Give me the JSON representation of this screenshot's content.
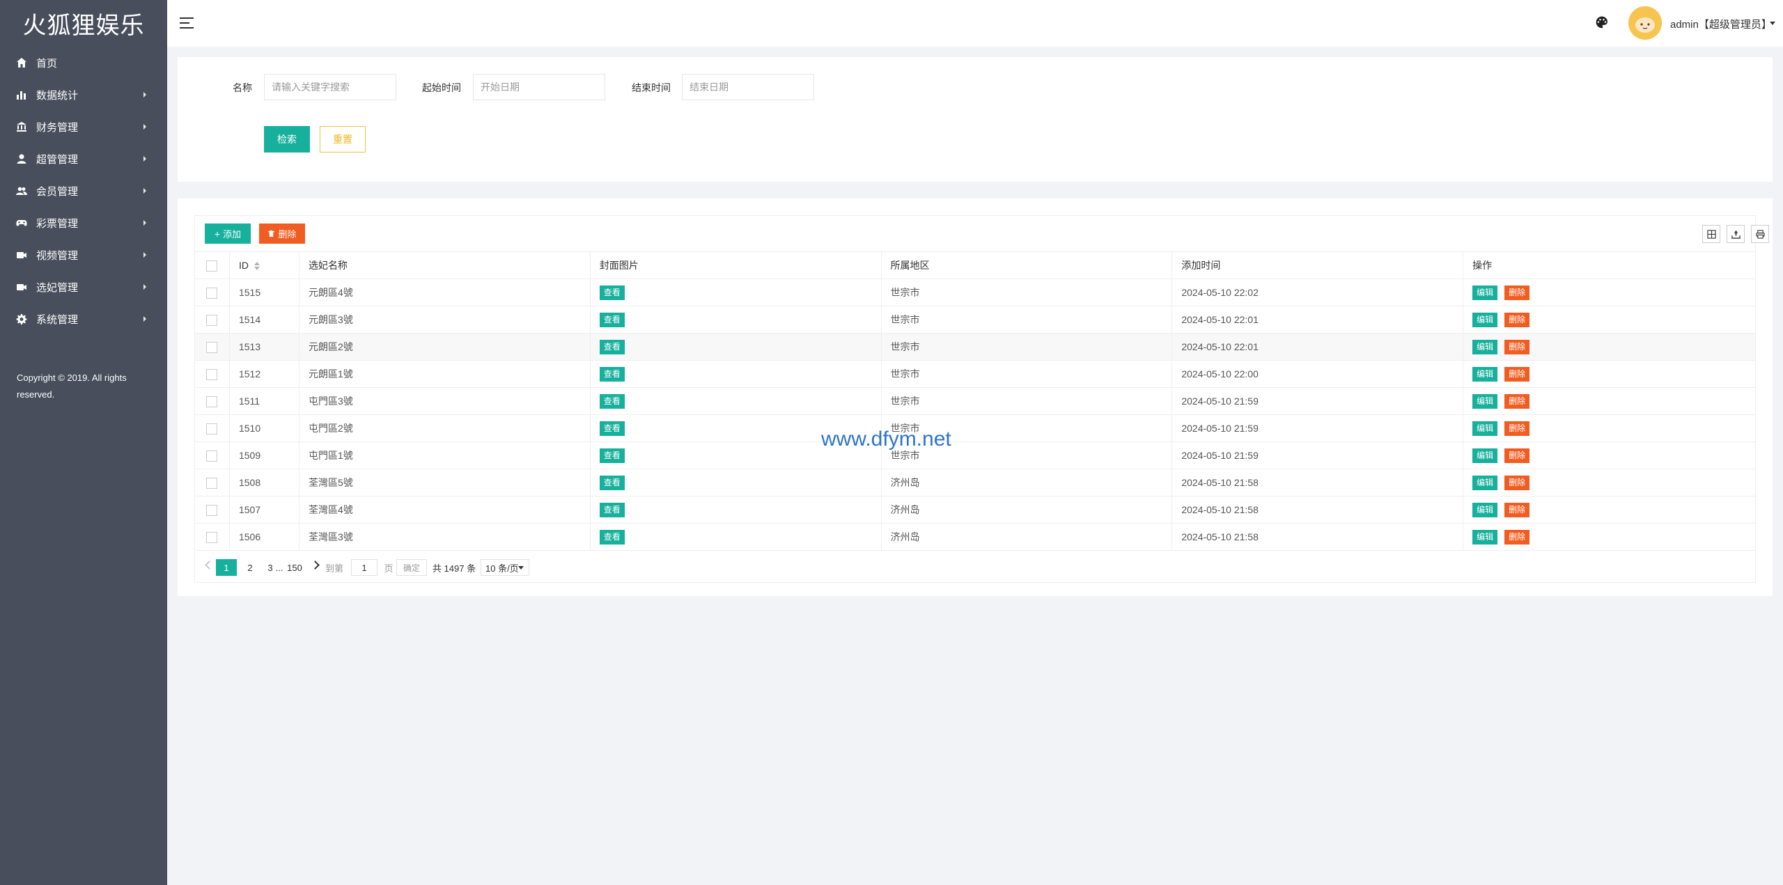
{
  "app": {
    "title": "火狐狸娱乐"
  },
  "sidebar": {
    "items": [
      {
        "label": "首页",
        "icon": "home-icon",
        "has_children": false
      },
      {
        "label": "数据统计",
        "icon": "bar-chart-icon",
        "has_children": true
      },
      {
        "label": "财务管理",
        "icon": "bank-icon",
        "has_children": true
      },
      {
        "label": "超管管理",
        "icon": "user-icon",
        "has_children": true
      },
      {
        "label": "会员管理",
        "icon": "users-icon",
        "has_children": true
      },
      {
        "label": "彩票管理",
        "icon": "gamepad-icon",
        "has_children": true
      },
      {
        "label": "视频管理",
        "icon": "video-icon",
        "has_children": true
      },
      {
        "label": "选妃管理",
        "icon": "video-camera-icon",
        "has_children": true
      },
      {
        "label": "系统管理",
        "icon": "gear-icon",
        "has_children": true
      }
    ],
    "copyright": "Copyright © 2019. All rights reserved."
  },
  "header": {
    "user": "admin【超级管理员】"
  },
  "search": {
    "name_label": "名称",
    "name_placeholder": "请输入关键字搜索",
    "start_label": "起始时间",
    "start_placeholder": "开始日期",
    "end_label": "结束时间",
    "end_placeholder": "结束日期",
    "search_button": "检索",
    "reset_button": "重置"
  },
  "toolbar": {
    "add_label": "添加",
    "delete_label": "删除"
  },
  "table": {
    "columns": [
      "ID",
      "选妃名称",
      "封面图片",
      "所属地区",
      "添加时间",
      "操作"
    ],
    "view_label": "查看",
    "edit_label": "编辑",
    "delete_label": "删除",
    "rows": [
      {
        "id": "1515",
        "name": "元朗區4號",
        "region": "世宗市",
        "time": "2024-05-10 22:02"
      },
      {
        "id": "1514",
        "name": "元朗區3號",
        "region": "世宗市",
        "time": "2024-05-10 22:01"
      },
      {
        "id": "1513",
        "name": "元朗區2號",
        "region": "世宗市",
        "time": "2024-05-10 22:01"
      },
      {
        "id": "1512",
        "name": "元朗區1號",
        "region": "世宗市",
        "time": "2024-05-10 22:00"
      },
      {
        "id": "1511",
        "name": "屯門區3號",
        "region": "世宗市",
        "time": "2024-05-10 21:59"
      },
      {
        "id": "1510",
        "name": "屯門區2號",
        "region": "世宗市",
        "time": "2024-05-10 21:59"
      },
      {
        "id": "1509",
        "name": "屯門區1號",
        "region": "世宗市",
        "time": "2024-05-10 21:59"
      },
      {
        "id": "1508",
        "name": "荃灣區5號",
        "region": "济州岛",
        "time": "2024-05-10 21:58"
      },
      {
        "id": "1507",
        "name": "荃灣區4號",
        "region": "济州岛",
        "time": "2024-05-10 21:58"
      },
      {
        "id": "1506",
        "name": "荃灣區3號",
        "region": "济州岛",
        "time": "2024-05-10 21:58"
      }
    ]
  },
  "pager": {
    "pages": [
      "1",
      "2",
      "3"
    ],
    "ellipsis": "...",
    "last_page": "150",
    "goto_label": "到第",
    "goto_value": "1",
    "page_unit": "页",
    "confirm": "确定",
    "total": "共 1497 条",
    "page_size": "10 条/页"
  },
  "watermark": "www.dfym.net",
  "colors": {
    "sidebar_bg": "#484e5b",
    "accent": "#16b09c",
    "danger": "#f15c20",
    "warning": "#f0b61e"
  }
}
